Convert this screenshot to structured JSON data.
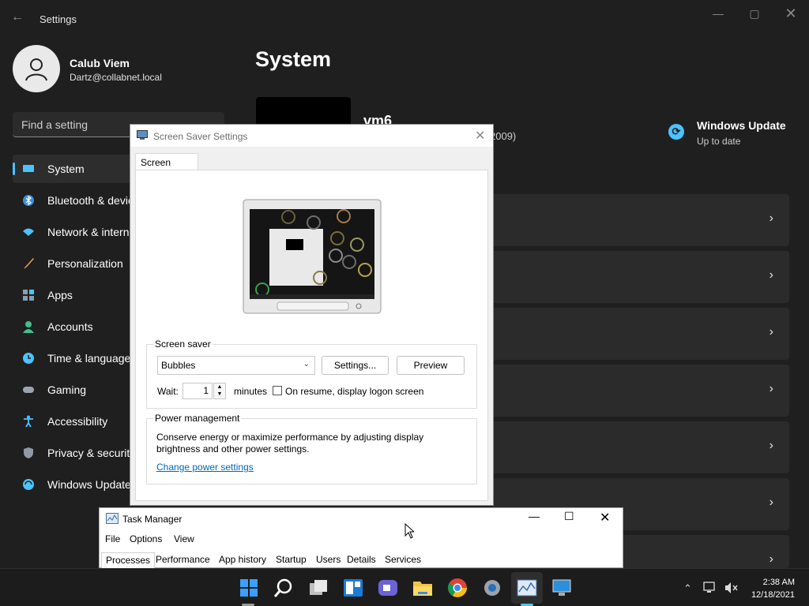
{
  "settings": {
    "window_title": "Settings",
    "user": {
      "name": "Calub Viem",
      "email": "Dartz@collabnet.local"
    },
    "search_placeholder": "Find a setting",
    "nav": [
      {
        "label": "System",
        "icon": "monitor-icon",
        "active": true
      },
      {
        "label": "Bluetooth & devices",
        "icon": "bluetooth-icon"
      },
      {
        "label": "Network & internet",
        "icon": "wifi-icon"
      },
      {
        "label": "Personalization",
        "icon": "brush-icon"
      },
      {
        "label": "Apps",
        "icon": "apps-icon"
      },
      {
        "label": "Accounts",
        "icon": "person-icon"
      },
      {
        "label": "Time & language",
        "icon": "clock-globe-icon"
      },
      {
        "label": "Gaming",
        "icon": "gamepad-icon"
      },
      {
        "label": "Accessibility",
        "icon": "accessibility-icon"
      },
      {
        "label": "Privacy & security",
        "icon": "shield-icon"
      },
      {
        "label": "Windows Update",
        "icon": "update-icon"
      }
    ],
    "page_title": "System",
    "device_name": "vm6",
    "device_sub": "2009)",
    "windows_update": {
      "title": "Windows Update",
      "status": "Up to date"
    }
  },
  "screensaver_dialog": {
    "title": "Screen Saver Settings",
    "tab_label": "Screen Saver",
    "group_label": "Screen saver",
    "selected_saver": "Bubbles",
    "settings_button": "Settings...",
    "preview_button": "Preview",
    "wait_label": "Wait:",
    "wait_value": "1",
    "minutes_label": "minutes",
    "resume_checkbox_label": "On resume, display logon screen",
    "resume_checked": false,
    "power_group_label": "Power management",
    "power_text_line1": "Conserve energy or maximize performance by adjusting display",
    "power_text_line2": "brightness and other power settings.",
    "power_link": "Change power settings"
  },
  "task_manager": {
    "title": "Task Manager",
    "menu": [
      "File",
      "Options",
      "View"
    ],
    "tabs": [
      "Processes",
      "Performance",
      "App history",
      "Startup",
      "Users",
      "Details",
      "Services"
    ],
    "active_tab": "Processes"
  },
  "taskbar": {
    "time": "2:38 AM",
    "date": "12/18/2021",
    "apps": [
      "start-icon",
      "search-icon",
      "task-view-icon",
      "widgets-icon",
      "teams-chat-icon",
      "file-explorer-icon",
      "chrome-icon",
      "settings-gear-icon",
      "task-manager-icon",
      "remote-desktop-icon"
    ]
  },
  "colors": {
    "accent": "#4cc2ff",
    "link": "#0067c0",
    "settings_bg": "#1f1f1f"
  }
}
